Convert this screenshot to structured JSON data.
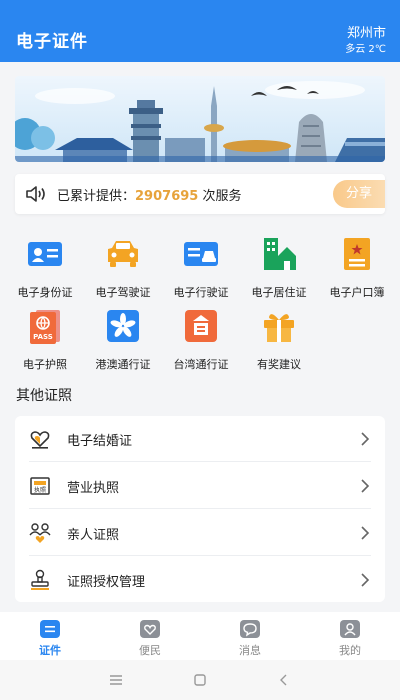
{
  "header": {
    "title": "电子证件",
    "city": "郑州市",
    "weather": "多云 2℃"
  },
  "notice": {
    "prefix": "已累计提供：",
    "count": "2907695",
    "suffix": " 次服务",
    "share_label": "分享"
  },
  "services": [
    {
      "label": "电子身份证",
      "icon": "id-card-icon"
    },
    {
      "label": "电子驾驶证",
      "icon": "car-icon"
    },
    {
      "label": "电子行驶证",
      "icon": "vehicle-license-icon"
    },
    {
      "label": "电子居住证",
      "icon": "building-house-icon"
    },
    {
      "label": "电子户口簿",
      "icon": "household-book-icon"
    },
    {
      "label": "电子护照",
      "icon": "passport-icon"
    },
    {
      "label": "港澳通行证",
      "icon": "hk-macao-permit-icon"
    },
    {
      "label": "台湾通行证",
      "icon": "taiwan-permit-icon"
    },
    {
      "label": "有奖建议",
      "icon": "gift-icon"
    }
  ],
  "other": {
    "title": "其他证照",
    "items": [
      {
        "label": "电子结婚证",
        "icon": "marriage-heart-icon"
      },
      {
        "label": "营业执照",
        "icon": "business-license-icon"
      },
      {
        "label": "亲人证照",
        "icon": "family-icon"
      },
      {
        "label": "证照授权管理",
        "icon": "authorization-stamp-icon"
      }
    ]
  },
  "passport_badge": "PASS",
  "license_badge": "执照",
  "tabs": [
    {
      "label": "证件",
      "active": true
    },
    {
      "label": "便民",
      "active": false
    },
    {
      "label": "消息",
      "active": false
    },
    {
      "label": "我的",
      "active": false
    }
  ],
  "colors": {
    "primary": "#2a86f0",
    "accent_orange": "#f3a423",
    "count_color": "#e7a33b"
  }
}
